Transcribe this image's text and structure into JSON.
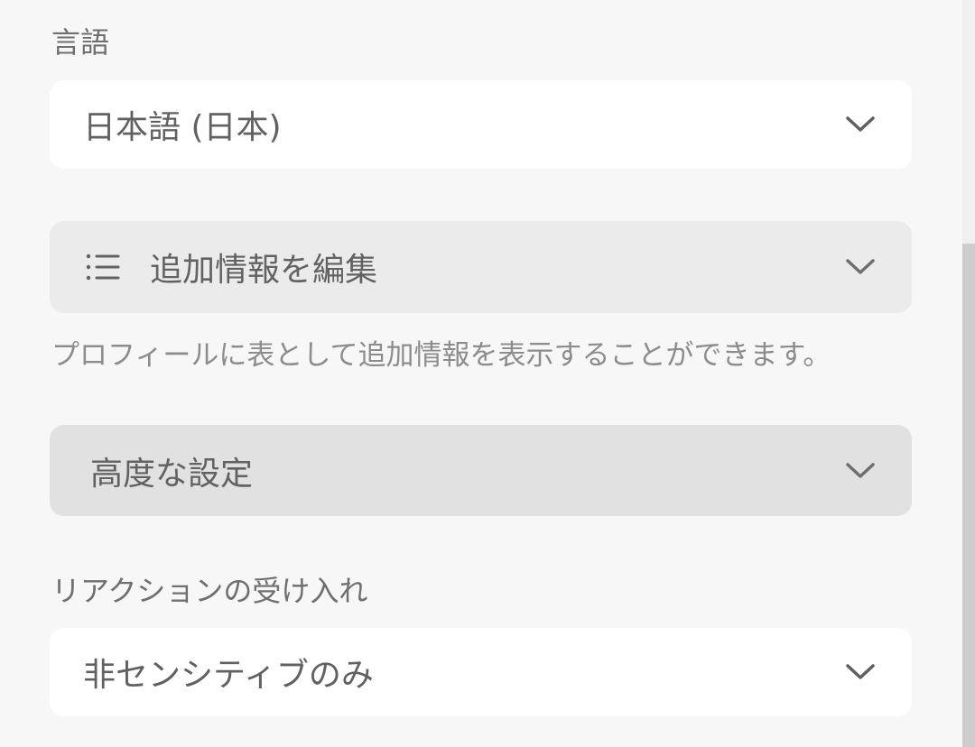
{
  "language": {
    "label": "言語",
    "selected": "日本語 (日本)"
  },
  "extra_info": {
    "title": "追加情報を編集",
    "hint": "プロフィールに表として追加情報を表示することができます。"
  },
  "advanced": {
    "title": "高度な設定"
  },
  "reactions": {
    "label": "リアクションの受け入れ",
    "selected": "非センシティブのみ"
  },
  "icons": {
    "chevron": "chevron-down-icon",
    "list": "list-icon"
  }
}
